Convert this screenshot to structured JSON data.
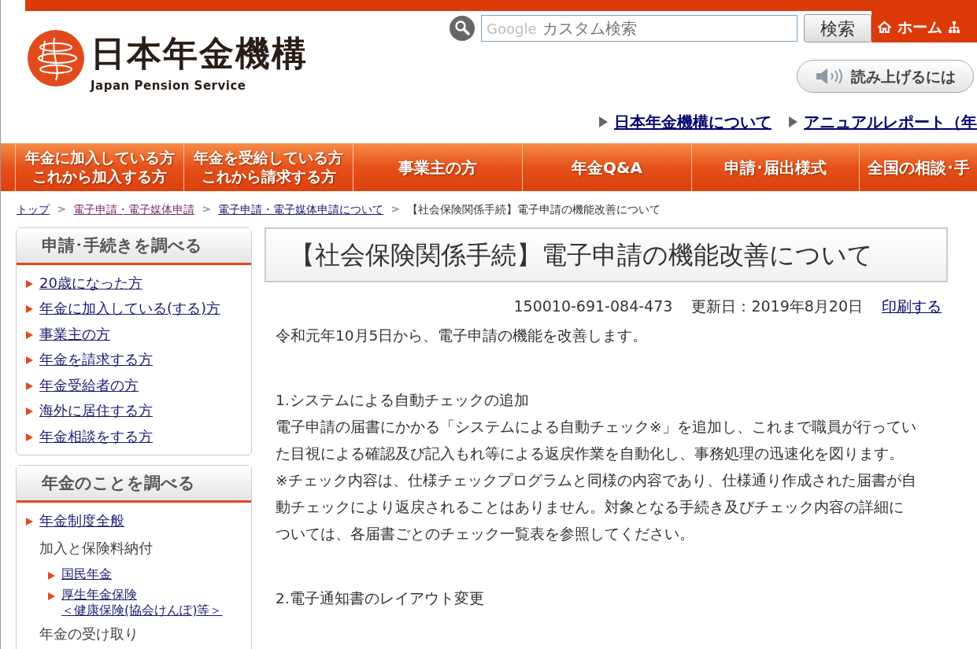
{
  "header": {
    "logo_title": "日本年金機構",
    "logo_subtitle": "Japan Pension Service",
    "search": {
      "placeholder": "カスタム検索",
      "brand_hint": "Google",
      "button": "検索"
    },
    "home_link": "ホーム",
    "read_aloud_button": "読み上げるには",
    "top_links": [
      "日本年金機構について",
      "アニュアルレポート（年"
    ]
  },
  "nav": [
    {
      "lines": [
        "年金に加入している方",
        "これから加入する方"
      ]
    },
    {
      "lines": [
        "年金を受給している方",
        "これから請求する方"
      ]
    },
    {
      "lines": [
        "事業主の方"
      ]
    },
    {
      "lines": [
        "年金Q&A"
      ]
    },
    {
      "lines": [
        "申請･届出様式"
      ]
    },
    {
      "lines": [
        "全国の相談･手"
      ]
    }
  ],
  "breadcrumb": [
    {
      "label": "トップ",
      "kind": "link",
      "visited": false
    },
    {
      "label": "電子申請・電子媒体申請",
      "kind": "link",
      "visited": true
    },
    {
      "label": "電子申請・電子媒体申請について",
      "kind": "link",
      "visited": false
    },
    {
      "label": "【社会保険関係手続】電子申請の機能改善について",
      "kind": "current"
    }
  ],
  "sidebar": [
    {
      "title": "申請･手続きを調べる",
      "items": [
        {
          "kind": "link",
          "lines": [
            "20歳になった方"
          ]
        },
        {
          "kind": "link",
          "lines": [
            "年金に加入している(する)方"
          ]
        },
        {
          "kind": "link",
          "lines": [
            "事業主の方"
          ]
        },
        {
          "kind": "link",
          "lines": [
            "年金を請求する方"
          ]
        },
        {
          "kind": "link",
          "lines": [
            "年金受給者の方"
          ]
        },
        {
          "kind": "link",
          "lines": [
            "海外に居住する方"
          ]
        },
        {
          "kind": "link",
          "lines": [
            "年金相談をする方"
          ]
        }
      ]
    },
    {
      "title": "年金のことを調べる",
      "items": [
        {
          "kind": "link",
          "lines": [
            "年金制度全般"
          ]
        },
        {
          "kind": "group",
          "lines": [
            "加入と保険料納付"
          ],
          "children": [
            {
              "kind": "link",
              "lines": [
                "国民年金"
              ]
            },
            {
              "kind": "link",
              "lines": [
                "厚生年金保険",
                "＜健康保険(協会けんぽ)等＞"
              ]
            }
          ]
        },
        {
          "kind": "group",
          "lines": [
            "年金の受け取り"
          ]
        }
      ]
    }
  ],
  "article": {
    "title": "【社会保険関係手続】電子申請の機能改善について",
    "page_id": "150010-691-084-473",
    "updated": "更新日：2019年8月20日",
    "print_link": "印刷する",
    "blocks": [
      {
        "kind": "text",
        "text": "令和元年10月5日から、電子申請の機能を改善します。"
      },
      {
        "kind": "gap"
      },
      {
        "kind": "text",
        "text": "1.システムによる自動チェックの追加"
      },
      {
        "kind": "text",
        "text": "電子申請の届書にかかる「システムによる自動チェック※」を追加し、これまで職員が行っていた目視による確認及び記入もれ等による返戻作業を自動化し、事務処理の迅速化を図ります。"
      },
      {
        "kind": "text",
        "text": "※チェック内容は、仕様チェックプログラムと同様の内容であり、仕様通り作成された届書が自動チェックにより返戻されることはありません。対象となる手続き及びチェック内容の詳細については、各届書ごとのチェック一覧表を参照してください。"
      },
      {
        "kind": "gap"
      },
      {
        "kind": "text",
        "text": "2.電子通知書のレイアウト変更"
      }
    ]
  }
}
